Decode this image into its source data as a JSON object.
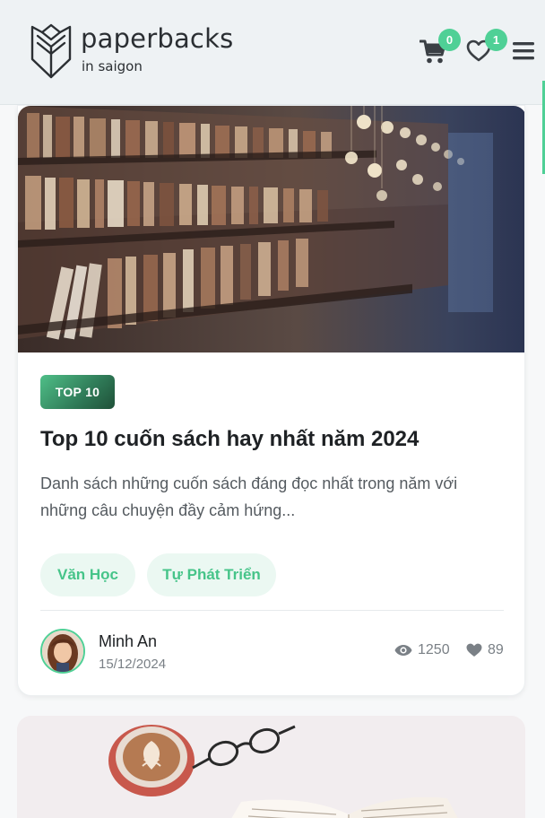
{
  "header": {
    "brand_name": "paperbacks",
    "brand_sub": "in saigon",
    "cart_count": "0",
    "wishlist_count": "1",
    "icons": [
      "book-logo-icon",
      "cart-icon",
      "heart-icon",
      "menu-icon"
    ],
    "accent_color": "#4fd096"
  },
  "post": {
    "badge": "TOP 10",
    "title": "Top 10 cuốn sách hay nhất năm 2024",
    "excerpt": "Danh sách những cuốn sách đáng đọc nhất trong năm với những câu chuyện đầy cảm hứng...",
    "categories": [
      "Văn Học",
      "Tự Phát Triển"
    ],
    "author": "Minh An",
    "date": "15/12/2024",
    "views": "1250",
    "likes": "89",
    "stat_icons": [
      "eye-icon",
      "heart-icon"
    ]
  }
}
